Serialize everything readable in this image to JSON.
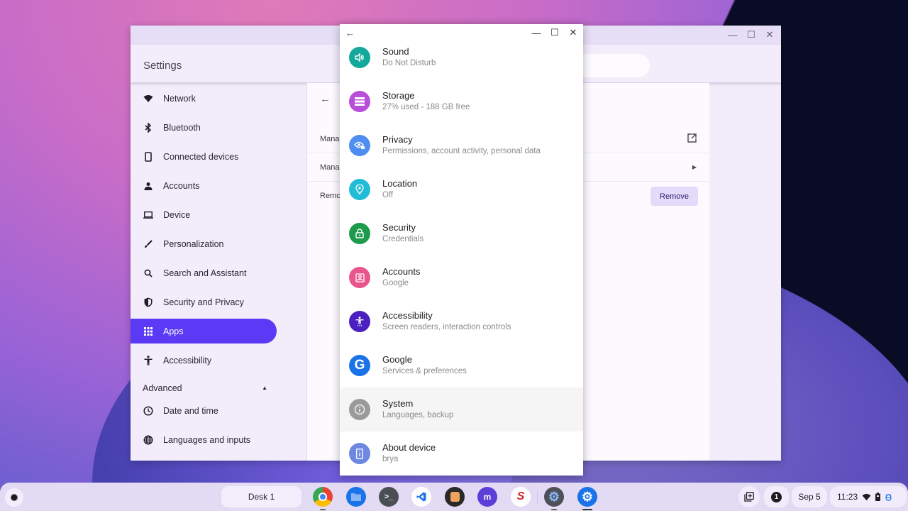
{
  "settings_window": {
    "title": "Settings",
    "window_controls": [
      "minimize",
      "maximize",
      "close"
    ],
    "sidebar": {
      "items": [
        {
          "label": "Network",
          "icon": "wifi-icon"
        },
        {
          "label": "Bluetooth",
          "icon": "bluetooth-icon"
        },
        {
          "label": "Connected devices",
          "icon": "phone-icon"
        },
        {
          "label": "Accounts",
          "icon": "person-icon"
        },
        {
          "label": "Device",
          "icon": "laptop-icon"
        },
        {
          "label": "Personalization",
          "icon": "brush-icon"
        },
        {
          "label": "Search and Assistant",
          "icon": "search-icon"
        },
        {
          "label": "Security and Privacy",
          "icon": "shield-icon"
        },
        {
          "label": "Apps",
          "icon": "apps-grid-icon",
          "active": true
        },
        {
          "label": "Accessibility",
          "icon": "accessibility-icon"
        }
      ],
      "advanced_label": "Advanced",
      "advanced_items": [
        {
          "label": "Date and time",
          "icon": "clock-icon"
        },
        {
          "label": "Languages and inputs",
          "icon": "globe-icon"
        }
      ]
    },
    "content": {
      "rows": [
        {
          "label": "Manag",
          "end": "external-link-icon"
        },
        {
          "label": "Manag",
          "end": "arrow-right-icon"
        },
        {
          "label": "Remo",
          "button": "Remove"
        }
      ]
    }
  },
  "android_settings": {
    "items": [
      {
        "title": "Sound",
        "subtitle": "Do Not Disturb",
        "icon": "volume-icon",
        "color": "#12a89a"
      },
      {
        "title": "Storage",
        "subtitle": "27% used - 188 GB free",
        "icon": "storage-icon",
        "color": "#b84fd8"
      },
      {
        "title": "Privacy",
        "subtitle": "Permissions, account activity, personal data",
        "icon": "privacy-eye-icon",
        "color": "#4f8ef0"
      },
      {
        "title": "Location",
        "subtitle": "Off",
        "icon": "location-pin-icon",
        "color": "#22bcd6"
      },
      {
        "title": "Security",
        "subtitle": "Credentials",
        "icon": "lock-icon",
        "color": "#1e9a4c"
      },
      {
        "title": "Accounts",
        "subtitle": "Google",
        "icon": "account-box-icon",
        "color": "#e8568c"
      },
      {
        "title": "Accessibility",
        "subtitle": "Screen readers, interaction controls",
        "icon": "accessibility-icon",
        "color": "#4c1fc0"
      },
      {
        "title": "Google",
        "subtitle": "Services & preferences",
        "icon": "google-g-icon",
        "color": "#1a73e8"
      },
      {
        "title": "System",
        "subtitle": "Languages, backup",
        "icon": "info-icon",
        "color": "#9a9a9a"
      },
      {
        "title": "About device",
        "subtitle": "brya",
        "icon": "device-info-icon",
        "color": "#6e88e0"
      }
    ]
  },
  "shelf": {
    "desk_label": "Desk 1",
    "apps": [
      {
        "name": "chrome",
        "color": "#e8453c"
      },
      {
        "name": "files",
        "color": "#1a73e8"
      },
      {
        "name": "terminal",
        "color": "#4a4f55"
      },
      {
        "name": "vscode",
        "color": "#ffffff"
      },
      {
        "name": "app-orange",
        "color": "#2a2a2a"
      },
      {
        "name": "mastodon",
        "color": "#5b3fd6"
      },
      {
        "name": "app-s",
        "color": "#ffffff"
      },
      {
        "name": "settings-gray",
        "color": "#4e5258"
      },
      {
        "name": "settings-blue",
        "color": "#1a73e8"
      }
    ],
    "notification_count": "1",
    "date": "Sep 5",
    "time": "11:23"
  }
}
